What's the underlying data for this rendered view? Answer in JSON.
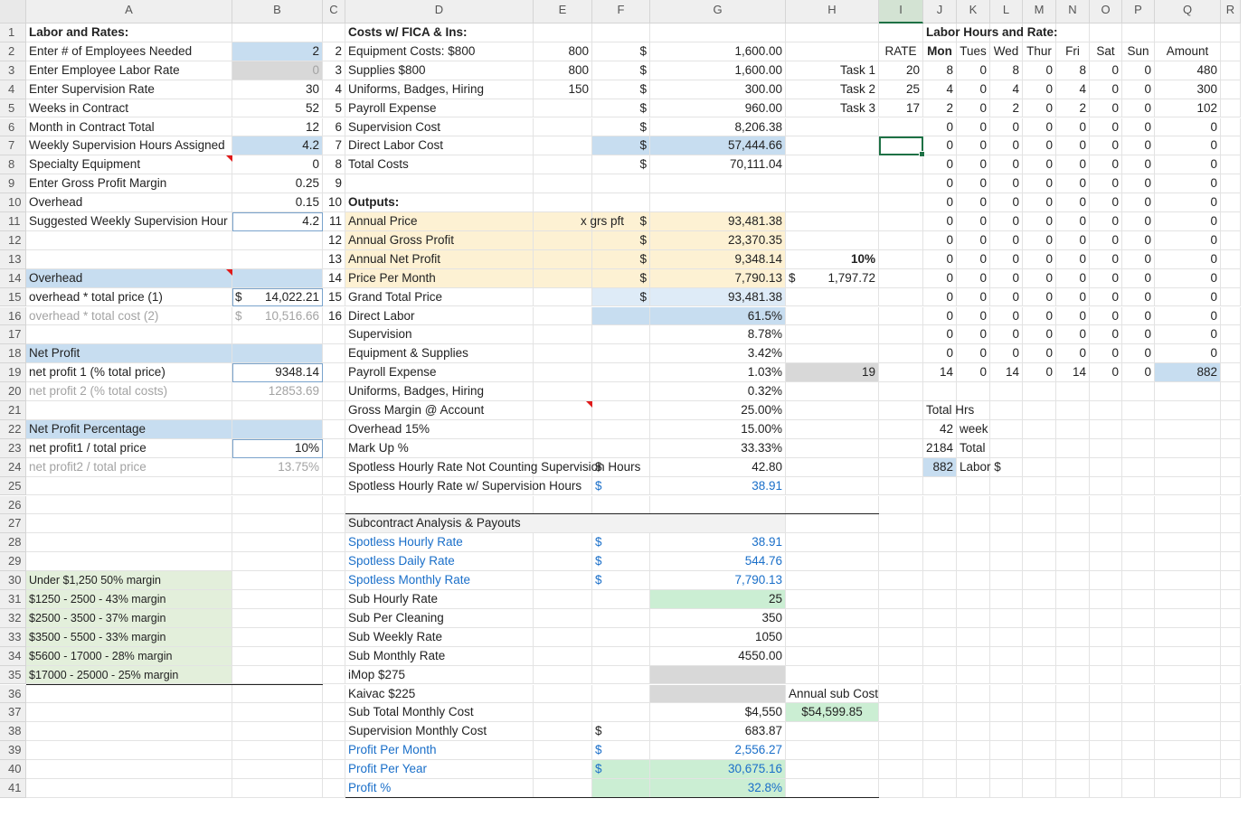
{
  "columns": [
    "A",
    "B",
    "C",
    "D",
    "E",
    "F",
    "G",
    "H",
    "I",
    "J",
    "K",
    "L",
    "M",
    "N",
    "O",
    "P",
    "Q",
    "R"
  ],
  "rows": [
    "1",
    "2",
    "3",
    "4",
    "5",
    "6",
    "7",
    "8",
    "9",
    "10",
    "11",
    "12",
    "13",
    "14",
    "15",
    "16",
    "17",
    "18",
    "19",
    "20",
    "21",
    "22",
    "23",
    "24",
    "25",
    "26",
    "27",
    "28",
    "29",
    "30",
    "31",
    "32",
    "33",
    "34",
    "35",
    "36",
    "37",
    "38",
    "39",
    "40",
    "41"
  ],
  "active_cell": "I7",
  "labor_section": {
    "title": "Labor and Rates:",
    "items": [
      {
        "label": "Enter # of Employees Needed",
        "value": "2"
      },
      {
        "label": "Enter Employee Labor Rate",
        "value": "0"
      },
      {
        "label": "Enter Supervision Rate",
        "value": "30"
      },
      {
        "label": "Weeks in Contract",
        "value": "52"
      },
      {
        "label": "Month in Contract Total",
        "value": "12"
      },
      {
        "label": "Weekly Supervision Hours Assigned",
        "value": "4.2"
      },
      {
        "label": "Specialty Equipment",
        "value": "0"
      },
      {
        "label": "Enter Gross Profit Margin",
        "value": "0.25"
      },
      {
        "label": "Overhead",
        "value": "0.15"
      },
      {
        "label": "Suggested Weekly Supervision Hour",
        "value": "4.2"
      }
    ],
    "overhead_header": "Overhead",
    "overhead_1": {
      "label": "overhead * total price (1)",
      "currency": "$",
      "value": "14,022.21"
    },
    "overhead_2": {
      "label": "overhead * total cost (2)",
      "currency": "$",
      "value": "10,516.66"
    },
    "net_profit_header": "Net Profit",
    "net_profit_1": {
      "label": "net profit 1  (% total price)",
      "value": "9348.14"
    },
    "net_profit_2": {
      "label": "net profit 2 (% total costs)",
      "value": "12853.69"
    },
    "net_profit_pct_header": "Net Profit Percentage",
    "net_profit_pct_1": {
      "label": "net profit1 / total price",
      "value": "10%"
    },
    "net_profit_pct_2": {
      "label": "net profit2 / total price",
      "value": "13.75%"
    },
    "margin_tiers": [
      "Under $1,250 50% margin",
      "$1250 - 2500 - 43% margin",
      "$2500 - 3500 - 37% margin",
      "$3500 - 5500 - 33% margin",
      "$5600 - 17000 - 28% margin",
      "$17000 - 25000 - 25% margin"
    ]
  },
  "costs_section": {
    "title": "Costs w/ FICA & Ins:",
    "items": [
      {
        "num": "2",
        "label": "Equipment Costs: $800",
        "e": "800",
        "cur": "$",
        "value": "1,600.00"
      },
      {
        "num": "3",
        "label": "Supplies $800",
        "e": "800",
        "cur": "$",
        "value": "1,600.00"
      },
      {
        "num": "4",
        "label": "Uniforms, Badges, Hiring",
        "e": "150",
        "cur": "$",
        "value": "300.00"
      },
      {
        "num": "5",
        "label": "Payroll Expense",
        "e": "",
        "cur": "$",
        "value": "960.00"
      },
      {
        "num": "6",
        "label": "Supervision Cost",
        "e": "",
        "cur": "$",
        "value": "8,206.38"
      },
      {
        "num": "7",
        "label": "Direct Labor Cost",
        "e": "",
        "cur": "$",
        "value": "57,444.66"
      },
      {
        "num": "8",
        "label": "Total Costs",
        "e": "",
        "cur": "$",
        "value": "70,111.04"
      }
    ],
    "num_9": "9",
    "num_10": "10",
    "outputs_title": "Outputs:",
    "outputs": [
      {
        "num": "11",
        "label": "Annual Price",
        "note": "x grs pft",
        "cur": "$",
        "value": "93,481.38"
      },
      {
        "num": "12",
        "label": "Annual Gross Profit",
        "cur": "$",
        "value": "23,370.35"
      },
      {
        "num": "13",
        "label": "Annual Net Profit",
        "cur": "$",
        "value": "9,348.14"
      },
      {
        "num": "14",
        "label": "Price Per Month",
        "cur": "$",
        "value": "7,790.13"
      }
    ],
    "h13": "10%",
    "h14_cur": "$",
    "h14": "1,797.72",
    "grand_total": {
      "num": "15",
      "label": "Grand Total Price",
      "cur": "$",
      "value": "93,481.38"
    },
    "direct_labor_pct": {
      "num": "16",
      "label": "Direct Labor",
      "value": "61.5%"
    },
    "pct_rows": [
      {
        "label": "Supervision",
        "value": "8.78%"
      },
      {
        "label": "Equipment & Supplies",
        "value": "3.42%"
      },
      {
        "label": "Payroll Expense",
        "value": "1.03%"
      },
      {
        "label": "Uniforms, Badges, Hiring",
        "value": "0.32%"
      },
      {
        "label": "Gross Margin @ Account",
        "value": "25.00%"
      },
      {
        "label": "Overhead 15%",
        "value": "15.00%"
      },
      {
        "label": "Mark Up %",
        "value": "33.33%"
      }
    ],
    "h19": "19",
    "hourly_not": {
      "label": "Spotless Hourly Rate Not Counting Supervision Hours",
      "cur": "$",
      "value": "42.80"
    },
    "hourly_with": {
      "label": "Spotless Hourly Rate w/ Supervision Hours",
      "cur": "$",
      "value": "38.91"
    }
  },
  "subcontract_section": {
    "title": "Subcontract Analysis & Payouts",
    "rows": [
      {
        "label": "Spotless Hourly Rate",
        "cur": "$",
        "value": "38.91",
        "blue": true
      },
      {
        "label": "Spotless Daily Rate",
        "cur": "$",
        "value": "544.76",
        "blue": true
      },
      {
        "label": "Spotless Monthly Rate",
        "cur": "$",
        "value": "7,790.13",
        "blue": true
      },
      {
        "label": "Sub Hourly Rate",
        "cur": "",
        "value": "25",
        "blue": false
      },
      {
        "label": "Sub Per Cleaning",
        "cur": "",
        "value": "350",
        "blue": false
      },
      {
        "label": "Sub Weekly Rate",
        "cur": "",
        "value": "1050",
        "blue": false
      },
      {
        "label": "Sub Monthly Rate",
        "cur": "",
        "value": "4550.00",
        "blue": false
      },
      {
        "label": "iMop $275",
        "cur": "",
        "value": "",
        "blue": false
      },
      {
        "label": "Kaivac $225",
        "cur": "",
        "value": "",
        "blue": false
      },
      {
        "label": "Sub Total Monthly Cost",
        "cur": "",
        "value": "$4,550",
        "blue": false
      },
      {
        "label": "Supervision Monthly Cost",
        "cur": "$",
        "value": "683.87",
        "blue": false
      },
      {
        "label": "Profit Per Month",
        "cur": "$",
        "value": "2,556.27",
        "blue": true
      },
      {
        "label": "Profit Per Year",
        "cur": "$",
        "value": "30,675.16",
        "blue": true
      },
      {
        "label": "Profit %",
        "cur": "",
        "value": "32.8%",
        "blue": true
      }
    ],
    "annual_sub_cost_label": "Annual sub Cost",
    "annual_sub_cost_value": "$54,599.85"
  },
  "hours_section": {
    "title": "Labor Hours and Rate:",
    "rate_header": "RATE",
    "day_headers": [
      "Mon",
      "Tues",
      "Wed",
      "Thur",
      "Fri",
      "Sat",
      "Sun",
      "Amount"
    ],
    "tasks": [
      {
        "name": "Task 1",
        "rate": "20",
        "days": [
          "8",
          "0",
          "8",
          "0",
          "8",
          "0",
          "0"
        ],
        "amount": "480"
      },
      {
        "name": "Task 2",
        "rate": "25",
        "days": [
          "4",
          "0",
          "4",
          "0",
          "4",
          "0",
          "0"
        ],
        "amount": "300"
      },
      {
        "name": "Task 3",
        "rate": "17",
        "days": [
          "2",
          "0",
          "2",
          "0",
          "2",
          "0",
          "0"
        ],
        "amount": "102"
      }
    ],
    "zero": "0",
    "totals": {
      "days": [
        "14",
        "0",
        "14",
        "0",
        "14",
        "0",
        "0"
      ],
      "amount": "882"
    },
    "total_hrs_label": "Total Hrs",
    "weekly_hours": "42",
    "weekly_label": "week",
    "total_hours": "2184",
    "total_label": "Total",
    "labor_dollars": "882",
    "labor_label": "Labor $"
  }
}
